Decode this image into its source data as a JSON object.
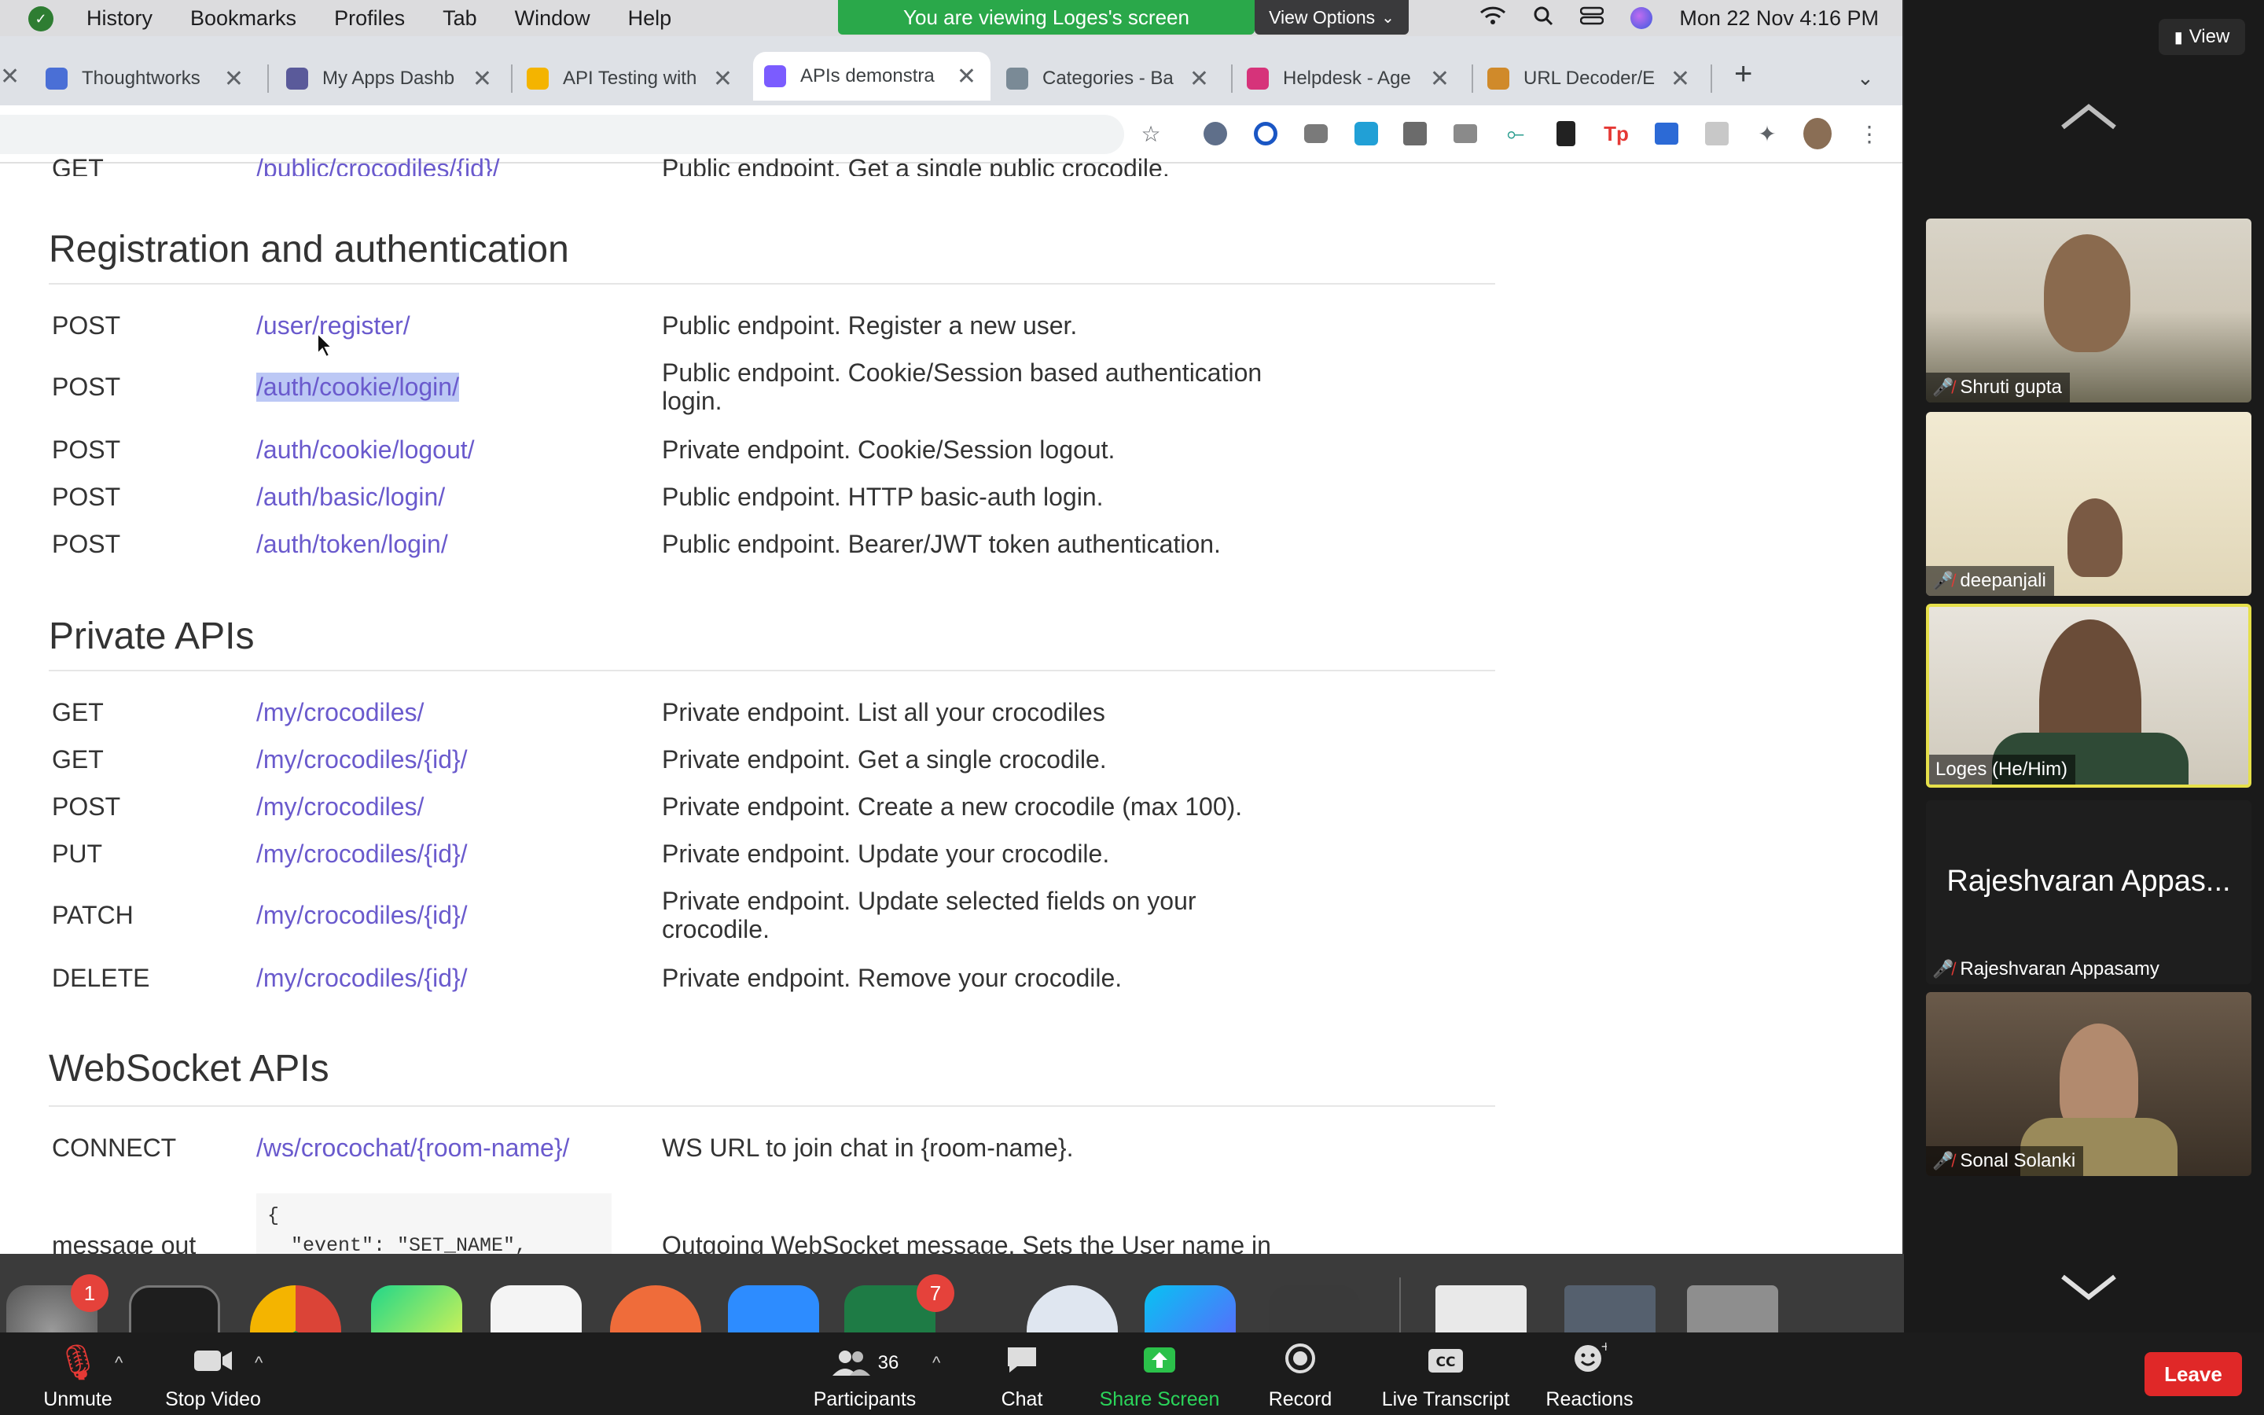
{
  "menubar": {
    "items": [
      "History",
      "Bookmarks",
      "Profiles",
      "Tab",
      "Window",
      "Help"
    ],
    "clock": "Mon 22 Nov  4:16 PM"
  },
  "zoom_banner": {
    "viewing_text": "You are viewing Loges's screen",
    "view_options_label": "View Options"
  },
  "browser": {
    "tabs": [
      {
        "title": "Thoughtworks",
        "favicon_color": "#4a6fd6",
        "active": false
      },
      {
        "title": "My Apps Dashb",
        "favicon_color": "#5a5a9a",
        "active": false
      },
      {
        "title": "API Testing with",
        "favicon_color": "#f4b400",
        "active": false
      },
      {
        "title": "APIs demonstra",
        "favicon_color": "#7b5cff",
        "active": true
      },
      {
        "title": "Categories - Ba",
        "favicon_color": "#7a8a96",
        "active": false
      },
      {
        "title": "Helpdesk - Age",
        "favicon_color": "#d6337a",
        "active": false
      },
      {
        "title": "URL Decoder/E",
        "favicon_color": "#d08a2a",
        "active": false
      }
    ],
    "new_tab_label": "+"
  },
  "page": {
    "sections": [
      {
        "heading": "Registration and authentication",
        "rows": [
          {
            "method": "POST",
            "endpoint": "/user/register/",
            "desc": "Public endpoint. Register a new user."
          },
          {
            "method": "POST",
            "endpoint": "/auth/cookie/login/",
            "desc": "Public endpoint. Cookie/Session based authentication login."
          },
          {
            "method": "POST",
            "endpoint": "/auth/cookie/logout/",
            "desc": "Private endpoint. Cookie/Session logout."
          },
          {
            "method": "POST",
            "endpoint": "/auth/basic/login/",
            "desc": "Public endpoint. HTTP basic-auth login."
          },
          {
            "method": "POST",
            "endpoint": "/auth/token/login/",
            "desc": "Public endpoint. Bearer/JWT token authentication."
          }
        ]
      },
      {
        "heading": "Private APIs",
        "rows": [
          {
            "method": "GET",
            "endpoint": "/my/crocodiles/",
            "desc": "Private endpoint. List all your crocodiles"
          },
          {
            "method": "GET",
            "endpoint": "/my/crocodiles/{id}/",
            "desc": "Private endpoint. Get a single crocodile."
          },
          {
            "method": "POST",
            "endpoint": "/my/crocodiles/",
            "desc": "Private endpoint. Create a new crocodile (max 100)."
          },
          {
            "method": "PUT",
            "endpoint": "/my/crocodiles/{id}/",
            "desc": "Private endpoint. Update your crocodile."
          },
          {
            "method": "PATCH",
            "endpoint": "/my/crocodiles/{id}/",
            "desc": "Private endpoint. Update selected fields on your crocodile."
          },
          {
            "method": "DELETE",
            "endpoint": "/my/crocodiles/{id}/",
            "desc": "Private endpoint. Remove your crocodile."
          }
        ]
      },
      {
        "heading": "WebSocket APIs",
        "rows": [
          {
            "method": "CONNECT",
            "endpoint": "/ws/crocochat/{room-name}/",
            "desc": "WS URL to join chat in {room-name}."
          },
          {
            "method": "message out",
            "endpoint": "",
            "desc": "Outgoing WebSocket message. Sets the User name in"
          }
        ]
      }
    ],
    "code_sample": "{\n  \"event\": \"SET_NAME\","
  },
  "dock": {
    "badges": [
      "1",
      "7"
    ]
  },
  "participants_panel": {
    "view_label": "View",
    "participants": [
      {
        "name": "Shruti gupta",
        "muted": true
      },
      {
        "name": "deepanjali",
        "muted": true
      },
      {
        "name": "Loges  (He/Him)",
        "muted": false,
        "active_speaker": true
      },
      {
        "name": "Rajeshvaran Appasamy",
        "display_name": "Rajeshvaran Appas...",
        "muted": true,
        "video": false
      },
      {
        "name": "Sonal Solanki",
        "muted": true
      }
    ]
  },
  "toolbar": {
    "unmute": "Unmute",
    "stop_video": "Stop Video",
    "participants": "Participants",
    "participants_count": "36",
    "chat": "Chat",
    "share_screen": "Share Screen",
    "record": "Record",
    "live_transcript": "Live Transcript",
    "reactions": "Reactions",
    "leave": "Leave"
  }
}
